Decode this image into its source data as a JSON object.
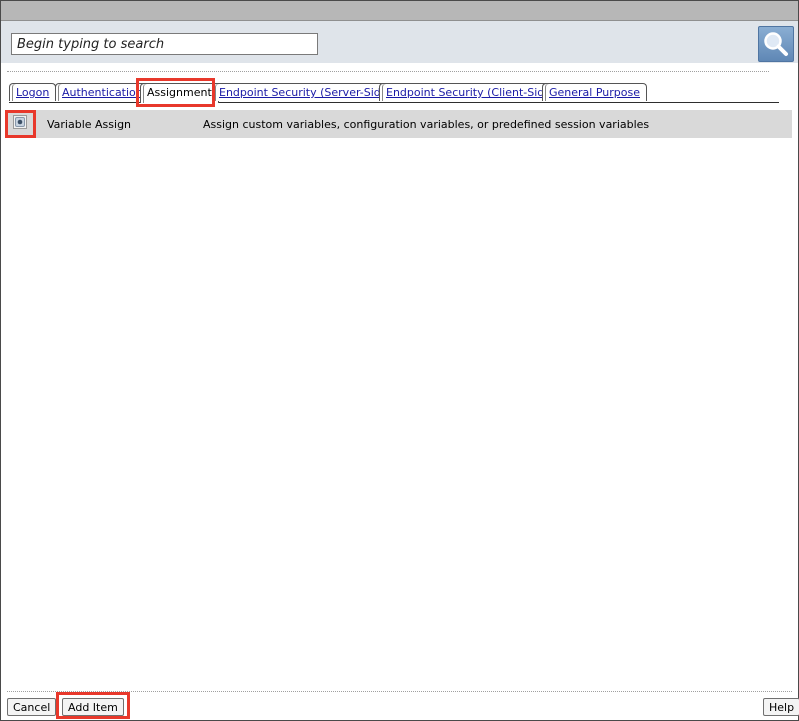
{
  "search": {
    "placeholder": "Begin typing to search",
    "button_icon": "magnifier-icon"
  },
  "tabs": [
    {
      "label": "Logon",
      "active": false
    },
    {
      "label": "Authentication",
      "active": false
    },
    {
      "label": "Assignment",
      "active": true
    },
    {
      "label": "Endpoint Security (Server-Side)",
      "active": false
    },
    {
      "label": "Endpoint Security (Client-Side)",
      "active": false
    },
    {
      "label": "General Purpose",
      "active": false
    }
  ],
  "items": [
    {
      "name": "Variable Assign",
      "description": "Assign custom variables, configuration variables, or predefined session variables",
      "selected": true
    }
  ],
  "footer": {
    "cancel_label": "Cancel",
    "add_label": "Add Item",
    "help_label": "Help"
  },
  "colors": {
    "highlight": "#e8382b",
    "link": "#1a1aa6",
    "search_bar": "#dfe4ea",
    "row_background": "#d9d9d9"
  }
}
